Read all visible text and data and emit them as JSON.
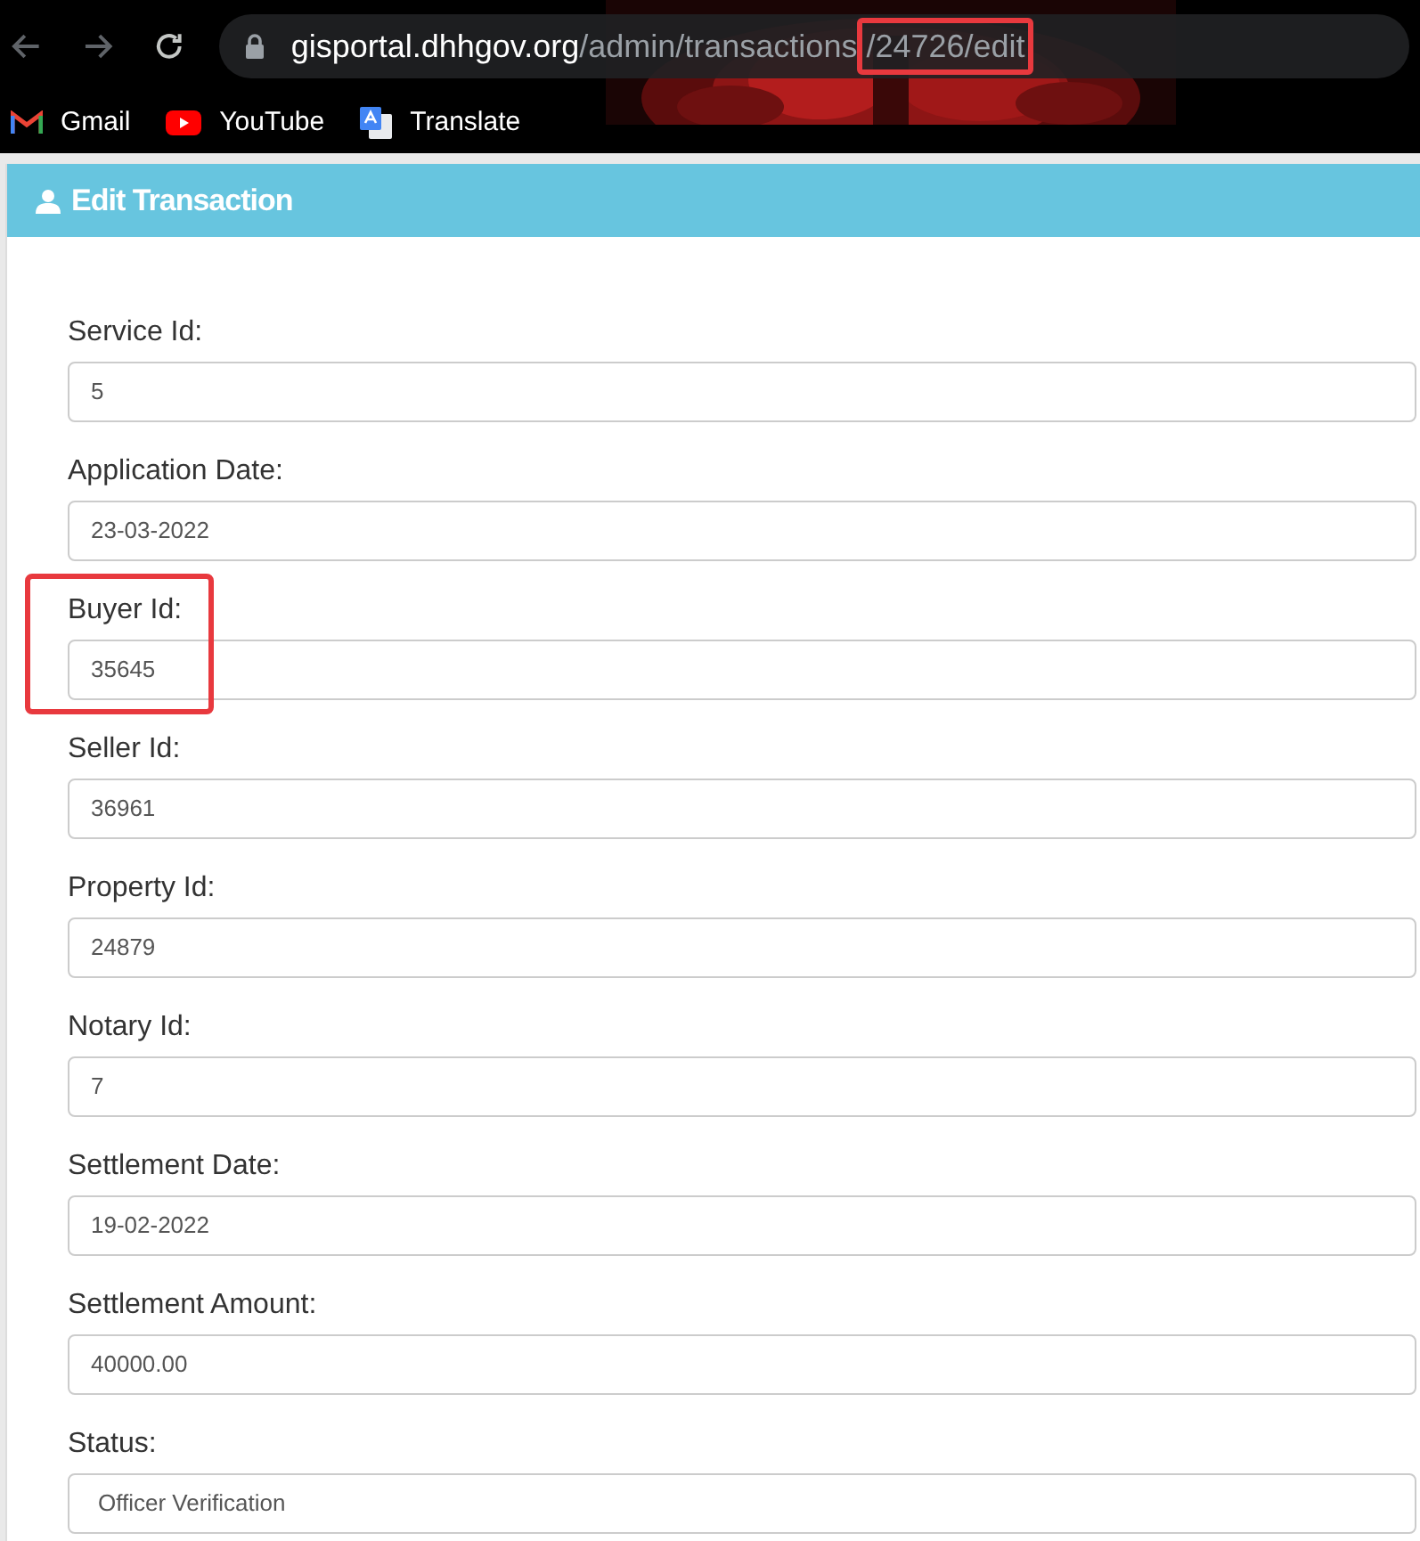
{
  "browser": {
    "url_host": "gisportal.dhhgov.org",
    "url_path": "/admin/transactions",
    "url_highlighted": "/24726/edit",
    "bookmarks": [
      {
        "label": "Gmail",
        "kind": "gmail"
      },
      {
        "label": "YouTube",
        "kind": "youtube"
      },
      {
        "label": "Translate",
        "kind": "translate"
      }
    ]
  },
  "panel": {
    "title": "Edit Transaction"
  },
  "fields": [
    {
      "label": "Service Id:",
      "value": "5",
      "kind": "text",
      "highlighted": false
    },
    {
      "label": "Application Date:",
      "value": "23-03-2022",
      "kind": "text",
      "highlighted": false
    },
    {
      "label": "Buyer Id:",
      "value": "35645",
      "kind": "text",
      "highlighted": true
    },
    {
      "label": "Seller Id:",
      "value": "36961",
      "kind": "text",
      "highlighted": false
    },
    {
      "label": "Property Id:",
      "value": "24879",
      "kind": "text",
      "highlighted": false
    },
    {
      "label": "Notary Id:",
      "value": "7",
      "kind": "text",
      "highlighted": false
    },
    {
      "label": "Settlement Date:",
      "value": "19-02-2022",
      "kind": "text",
      "highlighted": false
    },
    {
      "label": "Settlement Amount:",
      "value": "40000.00",
      "kind": "text",
      "highlighted": false
    },
    {
      "label": "Status:",
      "value": "Officer Verification",
      "kind": "select",
      "highlighted": false
    }
  ]
}
